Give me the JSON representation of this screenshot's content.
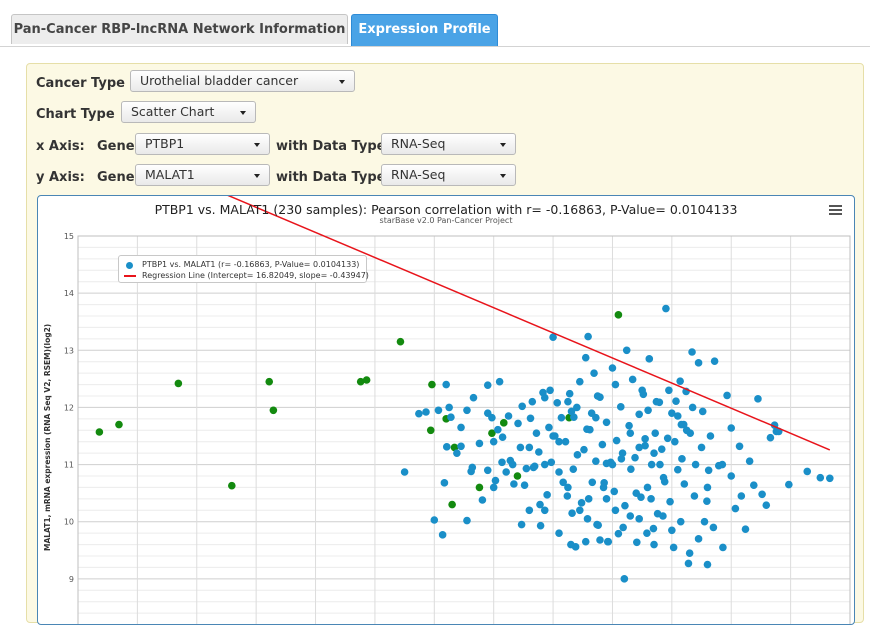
{
  "tabs": [
    {
      "label": "Pan-Cancer RBP-lncRNA Network Information",
      "active": false
    },
    {
      "label": "Expression Profile",
      "active": true
    }
  ],
  "form": {
    "cancer_type_label": "Cancer Type",
    "cancer_type_value": "Urothelial bladder cancer",
    "chart_type_label": "Chart Type",
    "chart_type_value": "Scatter Chart",
    "x_axis_label": "x Axis:",
    "y_axis_label": "y Axis:",
    "gene_label": "Gene",
    "with_data_type_label": "with Data Type",
    "x_gene_value": "PTBP1",
    "x_data_type_value": "RNA-Seq",
    "y_gene_value": "MALAT1",
    "y_data_type_value": "RNA-Seq"
  },
  "chart": {
    "title": "PTBP1 vs. MALAT1 (230 samples): Pearson correlation with r= -0.16863, P-Value= 0.0104133",
    "subtitle": "starBase v2.0 Pan-Cancer Project",
    "ylabel": "MALAT1, mRNA expression (RNA Seq V2, RSEM)(log2)",
    "legend_scatter": "PTBP1 vs. MALAT1 (r= -0.16863, P-Value= 0.0104133)",
    "legend_line": "Regression Line (Intercept= 16.82049, slope= -0.43947)",
    "colors": {
      "normal": "#1a8fc8",
      "highlight": "#138a0f",
      "regression": "#e8141b",
      "grid": "#d9d9d9"
    },
    "menu_icon": "hamburger-menu-icon"
  },
  "chart_data": {
    "type": "scatter",
    "title": "PTBP1 vs. MALAT1 (230 samples): Pearson correlation with r= -0.16863, P-Value= 0.0104133",
    "subtitle": "starBase v2.0 Pan-Cancer Project",
    "ylabel": "MALAT1, mRNA expression (RNA Seq V2, RSEM)(log2)",
    "ylim": [
      8,
      15
    ],
    "xlim": [
      0,
      13
    ],
    "yticks": [
      8,
      9,
      10,
      11,
      12,
      13,
      14,
      15
    ],
    "grid": true,
    "legend_position": "top-left",
    "regression": {
      "intercept": 16.82049,
      "slope": -0.43947,
      "x_range": [
        0.36,
        12.66
      ]
    },
    "series": [
      {
        "name": "PTBP1 vs. MALAT1 (r= -0.16863, P-Value= 0.0104133)",
        "color": "#138a0f",
        "points": [
          [
            0.36,
            11.57
          ],
          [
            0.69,
            11.7
          ],
          [
            1.69,
            12.42
          ],
          [
            2.59,
            10.63
          ],
          [
            3.22,
            12.45
          ],
          [
            3.29,
            11.95
          ],
          [
            4.76,
            12.45
          ],
          [
            4.86,
            12.48
          ],
          [
            5.43,
            13.15
          ],
          [
            5.96,
            12.4
          ],
          [
            5.94,
            11.6
          ],
          [
            6.2,
            11.8
          ],
          [
            6.34,
            11.3
          ],
          [
            6.3,
            10.3
          ],
          [
            6.76,
            10.6
          ],
          [
            6.97,
            11.55
          ],
          [
            7.17,
            11.73
          ],
          [
            7.4,
            10.8
          ],
          [
            8.27,
            11.82
          ],
          [
            9.1,
            13.62
          ]
        ]
      },
      {
        "name": "PTBP1 vs. MALAT1 (r= -0.16863, P-Value= 0.0104133)",
        "color": "#1a8fc8",
        "points": [
          [
            5.5,
            10.87
          ],
          [
            5.74,
            11.89
          ],
          [
            5.86,
            11.92
          ],
          [
            6.0,
            10.03
          ],
          [
            6.07,
            11.95
          ],
          [
            6.14,
            9.77
          ],
          [
            6.17,
            10.68
          ],
          [
            6.21,
            11.31
          ],
          [
            6.28,
            11.83
          ],
          [
            6.38,
            11.2
          ],
          [
            6.45,
            11.32
          ],
          [
            6.55,
            10.02
          ],
          [
            6.62,
            10.88
          ],
          [
            6.76,
            11.37
          ],
          [
            6.9,
            12.39
          ],
          [
            6.97,
            11.82
          ],
          [
            7.03,
            10.72
          ],
          [
            7.07,
            11.61
          ],
          [
            7.14,
            11.04
          ],
          [
            7.21,
            10.87
          ],
          [
            7.28,
            11.07
          ],
          [
            7.34,
            10.66
          ],
          [
            7.41,
            11.72
          ],
          [
            7.48,
            12.02
          ],
          [
            7.55,
            10.93
          ],
          [
            7.62,
            11.81
          ],
          [
            7.69,
            10.97
          ],
          [
            7.72,
            11.55
          ],
          [
            7.76,
            11.22
          ],
          [
            7.79,
            9.93
          ],
          [
            7.83,
            12.26
          ],
          [
            7.86,
            12.17
          ],
          [
            7.9,
            10.47
          ],
          [
            7.93,
            11.65
          ],
          [
            7.97,
            11.04
          ],
          [
            8.0,
            13.23
          ],
          [
            8.03,
            11.5
          ],
          [
            8.07,
            12.08
          ],
          [
            8.1,
            10.87
          ],
          [
            8.14,
            11.82
          ],
          [
            8.17,
            10.69
          ],
          [
            8.21,
            11.4
          ],
          [
            8.24,
            10.45
          ],
          [
            8.28,
            12.24
          ],
          [
            8.31,
            11.93
          ],
          [
            8.34,
            10.92
          ],
          [
            8.38,
            9.56
          ],
          [
            8.41,
            11.17
          ],
          [
            8.45,
            12.45
          ],
          [
            8.48,
            10.33
          ],
          [
            8.52,
            11.26
          ],
          [
            8.55,
            12.87
          ],
          [
            8.59,
            13.24
          ],
          [
            8.62,
            11.61
          ],
          [
            8.66,
            10.69
          ],
          [
            8.69,
            12.6
          ],
          [
            8.72,
            11.06
          ],
          [
            8.76,
            9.94
          ],
          [
            8.79,
            12.18
          ],
          [
            8.83,
            11.35
          ],
          [
            8.86,
            10.68
          ],
          [
            8.9,
            11.74
          ],
          [
            8.93,
            9.65
          ],
          [
            8.97,
            11.04
          ],
          [
            9.0,
            12.69
          ],
          [
            9.03,
            10.53
          ],
          [
            9.07,
            11.42
          ],
          [
            9.1,
            9.79
          ],
          [
            9.14,
            12.01
          ],
          [
            9.17,
            11.2
          ],
          [
            9.21,
            10.28
          ],
          [
            9.24,
            13.0
          ],
          [
            9.28,
            11.68
          ],
          [
            9.31,
            10.92
          ],
          [
            9.34,
            12.49
          ],
          [
            9.38,
            11.12
          ],
          [
            9.41,
            9.64
          ],
          [
            9.45,
            11.88
          ],
          [
            9.48,
            10.43
          ],
          [
            9.52,
            12.23
          ],
          [
            9.55,
            11.33
          ],
          [
            9.59,
            10.6
          ],
          [
            9.62,
            12.85
          ],
          [
            9.66,
            11.0
          ],
          [
            9.69,
            9.88
          ],
          [
            9.72,
            11.55
          ],
          [
            9.76,
            10.14
          ],
          [
            9.79,
            12.09
          ],
          [
            9.83,
            11.27
          ],
          [
            9.86,
            10.77
          ],
          [
            9.9,
            13.73
          ],
          [
            9.93,
            11.46
          ],
          [
            9.97,
            10.35
          ],
          [
            10.0,
            11.9
          ],
          [
            10.03,
            9.55
          ],
          [
            10.07,
            12.11
          ],
          [
            10.1,
            10.91
          ],
          [
            10.14,
            12.46
          ],
          [
            10.17,
            11.1
          ],
          [
            10.21,
            10.66
          ],
          [
            10.24,
            12.28
          ],
          [
            10.28,
            9.27
          ],
          [
            10.31,
            11.55
          ],
          [
            10.34,
            12.97
          ],
          [
            10.38,
            10.45
          ],
          [
            10.45,
            12.78
          ],
          [
            10.52,
            11.93
          ],
          [
            10.59,
            10.36
          ],
          [
            10.72,
            12.81
          ],
          [
            10.79,
            10.98
          ],
          [
            10.86,
            9.55
          ],
          [
            10.93,
            12.21
          ],
          [
            11.0,
            11.64
          ],
          [
            11.07,
            10.23
          ],
          [
            11.14,
            11.32
          ],
          [
            11.17,
            10.45
          ],
          [
            11.24,
            9.87
          ],
          [
            11.31,
            11.06
          ],
          [
            11.38,
            10.64
          ],
          [
            11.45,
            12.15
          ],
          [
            11.52,
            10.48
          ],
          [
            11.59,
            10.29
          ],
          [
            11.66,
            11.47
          ],
          [
            11.73,
            11.69
          ],
          [
            11.76,
            11.58
          ],
          [
            11.8,
            11.58
          ],
          [
            11.97,
            10.65
          ],
          [
            12.28,
            10.88
          ],
          [
            12.5,
            10.77
          ],
          [
            12.66,
            10.76
          ],
          [
            6.64,
            10.95
          ],
          [
            6.81,
            10.38
          ],
          [
            6.9,
            10.9
          ],
          [
            7.0,
            11.4
          ],
          [
            7.15,
            11.48
          ],
          [
            7.32,
            11.0
          ],
          [
            7.45,
            11.3
          ],
          [
            7.52,
            10.64
          ],
          [
            7.6,
            11.3
          ],
          [
            7.67,
            10.95
          ],
          [
            7.86,
            11.0
          ],
          [
            8.0,
            11.5
          ],
          [
            8.1,
            11.4
          ],
          [
            8.35,
            11.83
          ],
          [
            8.57,
            11.62
          ],
          [
            8.72,
            11.82
          ],
          [
            8.9,
            11.02
          ],
          [
            9.0,
            11.0
          ],
          [
            9.15,
            11.1
          ],
          [
            9.3,
            11.55
          ],
          [
            9.45,
            11.3
          ],
          [
            9.55,
            11.45
          ],
          [
            9.6,
            11.95
          ],
          [
            9.7,
            11.2
          ],
          [
            9.8,
            11.0
          ],
          [
            9.95,
            12.3
          ],
          [
            10.05,
            11.4
          ],
          [
            10.2,
            11.7
          ],
          [
            10.35,
            12.0
          ],
          [
            10.5,
            11.3
          ],
          [
            10.65,
            11.5
          ],
          [
            10.85,
            11.0
          ],
          [
            11.0,
            10.8
          ],
          [
            8.32,
            10.15
          ],
          [
            8.45,
            10.2
          ],
          [
            8.58,
            10.05
          ],
          [
            8.74,
            9.95
          ],
          [
            8.9,
            10.4
          ],
          [
            9.05,
            10.2
          ],
          [
            9.18,
            9.9
          ],
          [
            9.3,
            10.1
          ],
          [
            9.45,
            10.05
          ],
          [
            9.58,
            9.8
          ],
          [
            9.7,
            9.6
          ],
          [
            9.85,
            10.1
          ],
          [
            10.0,
            9.85
          ],
          [
            10.15,
            10.0
          ],
          [
            10.3,
            9.45
          ],
          [
            10.45,
            9.7
          ],
          [
            10.6,
            9.25
          ],
          [
            10.7,
            9.9
          ],
          [
            7.47,
            9.95
          ],
          [
            7.6,
            10.2
          ],
          [
            7.78,
            10.3
          ],
          [
            8.1,
            9.8
          ],
          [
            8.3,
            9.6
          ],
          [
            8.55,
            9.65
          ],
          [
            8.79,
            9.68
          ],
          [
            8.92,
            9.65
          ],
          [
            9.2,
            9.0
          ],
          [
            10.16,
            11.7
          ],
          [
            10.25,
            11.6
          ],
          [
            10.4,
            11.0
          ],
          [
            9.5,
            12.3
          ],
          [
            9.74,
            12.1
          ],
          [
            9.05,
            12.4
          ],
          [
            8.75,
            12.2
          ],
          [
            8.65,
            11.9
          ],
          [
            8.4,
            12.0
          ],
          [
            8.25,
            12.1
          ],
          [
            7.95,
            12.3
          ],
          [
            7.65,
            12.1
          ],
          [
            7.25,
            11.85
          ],
          [
            7.1,
            12.45
          ],
          [
            6.66,
            12.17
          ],
          [
            6.45,
            11.65
          ],
          [
            6.25,
            12.0
          ],
          [
            10.1,
            11.85
          ],
          [
            10.55,
            10.0
          ],
          [
            10.6,
            10.6
          ],
          [
            10.62,
            10.9
          ],
          [
            7.86,
            10.2
          ],
          [
            8.25,
            10.6
          ],
          [
            8.6,
            10.4
          ],
          [
            8.85,
            10.6
          ],
          [
            9.4,
            10.5
          ],
          [
            9.65,
            10.4
          ],
          [
            9.88,
            10.7
          ],
          [
            6.2,
            12.4
          ],
          [
            6.9,
            11.9
          ],
          [
            6.55,
            11.95
          ],
          [
            7.0,
            10.6
          ]
        ]
      }
    ]
  }
}
